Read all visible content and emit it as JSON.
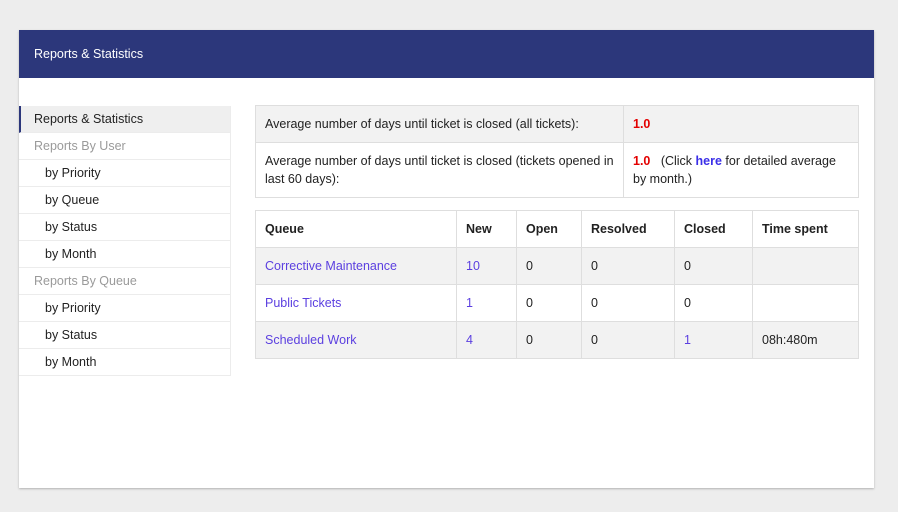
{
  "header": {
    "title": "Reports & Statistics"
  },
  "sidebar": {
    "items": [
      {
        "label": "Reports & Statistics",
        "type": "active"
      },
      {
        "label": "Reports By User",
        "type": "group"
      },
      {
        "label": "by Priority",
        "type": "item"
      },
      {
        "label": "by Queue",
        "type": "item"
      },
      {
        "label": "by Status",
        "type": "item"
      },
      {
        "label": "by Month",
        "type": "item"
      },
      {
        "label": "Reports By Queue",
        "type": "group"
      },
      {
        "label": "by Priority",
        "type": "item"
      },
      {
        "label": "by Status",
        "type": "item"
      },
      {
        "label": "by Month",
        "type": "item"
      }
    ]
  },
  "averages": {
    "all": {
      "label": "Average number of days until ticket is closed (all tickets):",
      "value": "1.0"
    },
    "last60": {
      "label": "Average number of days until ticket is closed (tickets opened in last 60 days):",
      "value": "1.0",
      "note_prefix": "(Click ",
      "link_text": "here",
      "note_suffix": " for detailed average by month.)"
    }
  },
  "queue_table": {
    "headers": [
      "Queue",
      "New",
      "Open",
      "Resolved",
      "Closed",
      "Time spent"
    ],
    "rows": [
      {
        "queue": "Corrective Maintenance",
        "new": "10",
        "open": "0",
        "resolved": "0",
        "closed": "0",
        "time_spent": ""
      },
      {
        "queue": "Public Tickets",
        "new": "1",
        "open": "0",
        "resolved": "0",
        "closed": "0",
        "time_spent": ""
      },
      {
        "queue": "Scheduled Work",
        "new": "4",
        "open": "0",
        "resolved": "0",
        "closed": "1",
        "time_spent": "08h:480m"
      }
    ]
  },
  "colors": {
    "header_bg": "#2c377b",
    "value_red": "#e30000",
    "link": "#5b3fe0"
  }
}
